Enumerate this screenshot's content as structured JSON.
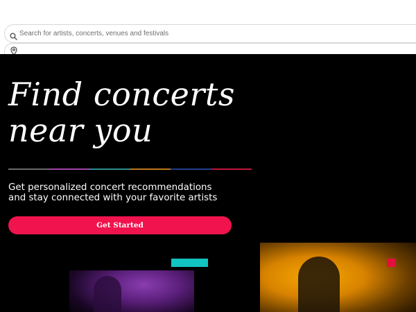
{
  "search": {
    "placeholder": "Search for artists, concerts, venues and festivals",
    "icon": "search-icon"
  },
  "location": {
    "icon": "location-pin-icon"
  },
  "hero": {
    "headline_line1": "Find concerts",
    "headline_line2": "near you",
    "subtext_line1": "Get personalized concert recommendations",
    "subtext_line2": "and stay connected with your favorite artists",
    "cta_label": "Get Started",
    "rule_colors": [
      "#6b6b6b",
      "#a347a8",
      "#2f8f8f",
      "#c27a1f",
      "#1f3f8f",
      "#c2183f"
    ],
    "accent_colors": {
      "cta": "#f0134d",
      "teal_block": "#12c3c3",
      "red_block": "#e3103e"
    }
  }
}
